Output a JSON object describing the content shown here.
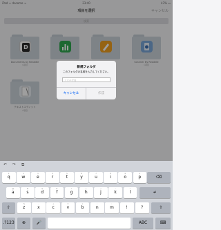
{
  "status": {
    "carrier": "iPad ᯤ docomo ᯤ",
    "time": "23:40",
    "battery": "43% ▭"
  },
  "nav": {
    "title": "項目を選択",
    "cancel": "キャンセル"
  },
  "search": {
    "placeholder": "検索"
  },
  "folders": [
    {
      "label": "Documents by Readdle",
      "sub": "1項目",
      "app_letter": "D",
      "app_color": "#2b2b2b"
    },
    {
      "label": "Numbers",
      "sub": "",
      "app_letter": "",
      "app_color": "#2fa84f"
    },
    {
      "label": "Pages",
      "sub": "",
      "app_letter": "",
      "app_color": "#f0a020"
    },
    {
      "label": "Scanner By Readdle",
      "sub": "1項目",
      "app_letter": "",
      "app_color": "#7aa6d8"
    },
    {
      "label": "テキストエディット",
      "sub": "1項目",
      "app_letter": "",
      "app_color": "#e9eef3"
    }
  ],
  "dialog": {
    "title": "新規フォルダ",
    "message": "このフォルダの名前を入力してください。",
    "placeholder": "フォルダ名",
    "cancel": "キャンセル",
    "create": "作成"
  },
  "keyboard": {
    "toolbar": {
      "undo": "↶",
      "redo": "↷",
      "paste": "⧉"
    },
    "row1": [
      "q",
      "w",
      "e",
      "r",
      "t",
      "y",
      "u",
      "i",
      "o",
      "p"
    ],
    "row2": [
      "a",
      "s",
      "d",
      "f",
      "g",
      "h",
      "j",
      "k",
      "l"
    ],
    "row3": [
      "z",
      "x",
      "c",
      "v",
      "b",
      "n",
      "m"
    ],
    "return": "↵",
    "delete": "⌫",
    "shift": "⇧",
    "punct1": "!",
    "punct2": "?",
    "numkey": ".?123",
    "globe": "⊕",
    "mic": "🎤",
    "abc": "ABC",
    "kbdismiss": "⌨",
    "hints2": [
      "@",
      "#",
      "$",
      "&",
      "*",
      "(",
      ")",
      "'",
      "\""
    ],
    "hints3": [
      "%",
      "-",
      "+",
      "=",
      "/",
      ";",
      ":"
    ]
  }
}
